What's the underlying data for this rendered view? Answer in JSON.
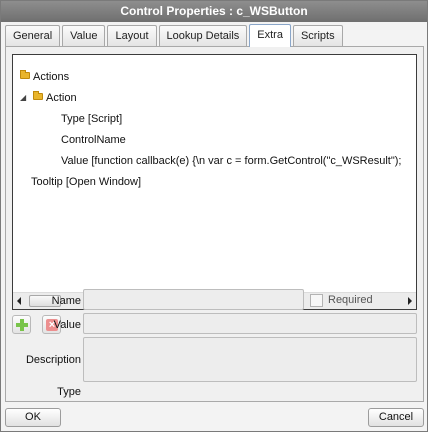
{
  "window": {
    "title": "Control Properties : c_WSButton"
  },
  "tabs": [
    {
      "label": "General",
      "active": false
    },
    {
      "label": "Value",
      "active": false
    },
    {
      "label": "Layout",
      "active": false
    },
    {
      "label": "Lookup Details",
      "active": false
    },
    {
      "label": "Extra",
      "active": true
    },
    {
      "label": "Scripts",
      "active": false
    }
  ],
  "tree": {
    "items": [
      {
        "label": "Actions",
        "icon": "folder-icon"
      },
      {
        "label": "Action",
        "icon": "folder-icon",
        "expanded": true
      },
      {
        "label": "Type [Script]"
      },
      {
        "label": "ControlName"
      },
      {
        "label": "Value [function callback(e) {\\n  var c = form.GetControl(\"c_WSResult\");"
      },
      {
        "label": "Tooltip [Open Window]"
      }
    ]
  },
  "toolbar": {
    "add_icon": "add-icon",
    "delete_icon": "delete-icon",
    "move_up_icon": "move-up-icon",
    "move_down_icon": "move-down-icon"
  },
  "form": {
    "name_label": "Name",
    "name_value": "",
    "required_label": "Required",
    "required_checked": false,
    "value_label": "Value",
    "value_value": "",
    "description_label": "Description",
    "description_value": "",
    "type_label": "Type"
  },
  "footer": {
    "ok_label": "OK",
    "cancel_label": "Cancel"
  }
}
